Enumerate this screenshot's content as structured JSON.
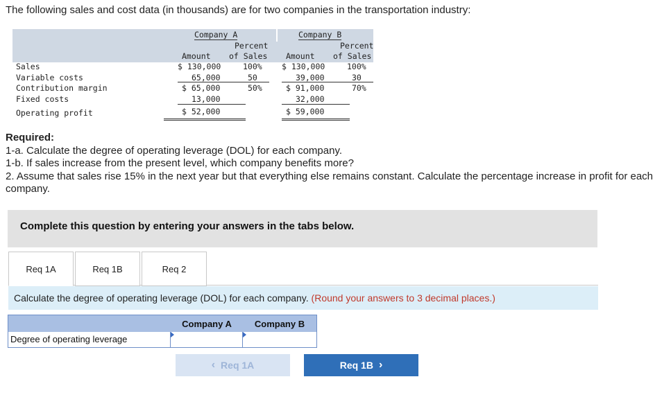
{
  "intro": "The following sales and cost data (in thousands) are for two companies in the transportation industry:",
  "table": {
    "company_a": "Company A",
    "company_b": "Company B",
    "amount": "Amount",
    "percent_line1": "Percent",
    "percent_line2": "of Sales",
    "rows": [
      {
        "label": "Sales",
        "a_amt": "$ 130,000",
        "a_pct": "100%",
        "b_amt": "$ 130,000",
        "b_pct": "100%"
      },
      {
        "label": "Variable costs",
        "a_amt": "65,000",
        "a_pct": "50",
        "b_amt": "39,000",
        "b_pct": "30"
      },
      {
        "label": "Contribution margin",
        "a_amt": "$ 65,000",
        "a_pct": "50%",
        "b_amt": "$ 91,000",
        "b_pct": "70%"
      },
      {
        "label": "Fixed costs",
        "a_amt": "13,000",
        "a_pct": "",
        "b_amt": "32,000",
        "b_pct": ""
      },
      {
        "label": "Operating profit",
        "a_amt": "$ 52,000",
        "a_pct": "",
        "b_amt": "$ 59,000",
        "b_pct": ""
      }
    ]
  },
  "required": {
    "title": "Required:",
    "items": [
      "1-a. Calculate the degree of operating leverage (DOL) for each company.",
      "1-b. If sales increase from the present level, which company benefits more?",
      "2. Assume that sales rise 15% in the next year but that everything else remains constant. Calculate the percentage increase in profit for each company."
    ]
  },
  "banner": "Complete this question by entering your answers in the tabs below.",
  "tabs": [
    "Req 1A",
    "Req 1B",
    "Req 2"
  ],
  "instruction": {
    "text": "Calculate the degree of operating leverage (DOL) for each company.",
    "round": "(Round your answers to 3 decimal places.)"
  },
  "answer": {
    "col_a": "Company A",
    "col_b": "Company B",
    "row_label": "Degree of operating leverage",
    "value_a": "",
    "value_b": ""
  },
  "nav": {
    "prev": "Req 1A",
    "next": "Req 1B",
    "prev_icon": "chevron-left-icon",
    "next_icon": "chevron-right-icon"
  },
  "colors": {
    "accent": "#2f6fb8",
    "table_header": "#cfd8e3",
    "round_note": "#c0392b"
  }
}
